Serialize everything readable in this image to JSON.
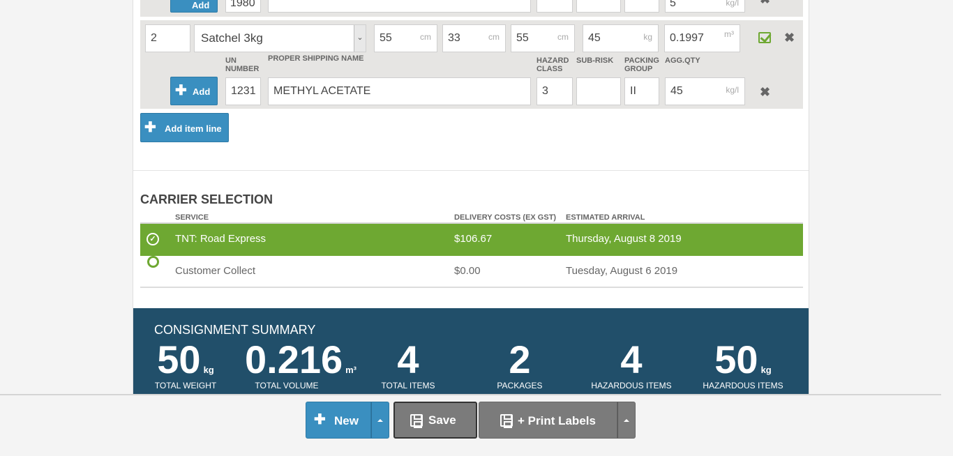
{
  "top_partial_row": {
    "un_number": "1980",
    "agg_qty": "5",
    "agg_unit": "kg/l",
    "add_label": "Add"
  },
  "item_line": {
    "quantity": "2",
    "package_type": "Satchel 3kg",
    "length": "55",
    "length_unit": "cm",
    "width": "33",
    "width_unit": "cm",
    "height": "55",
    "height_unit": "cm",
    "weight": "45",
    "weight_unit": "kg",
    "volume": "0.1997",
    "volume_unit": "m³"
  },
  "dg_headers": {
    "un_number": "UN NUMBER",
    "proper_shipping_name": "PROPER SHIPPING NAME",
    "hazard_class": "HAZARD CLASS",
    "sub_risk": "SUB-RISK",
    "packing_group": "PACKING GROUP",
    "agg_qty": "AGG.QTY"
  },
  "dg_line": {
    "add_label": "Add",
    "un_number": "1231",
    "proper_shipping_name": "METHYL ACETATE",
    "hazard_class": "3",
    "sub_risk": "",
    "packing_group": "II",
    "agg_qty": "45",
    "agg_unit": "kg/l"
  },
  "add_item_line_label": "Add item line",
  "carrier_selection": {
    "title": "CARRIER SELECTION",
    "col_service": "SERVICE",
    "col_cost": "DELIVERY COSTS (EX GST)",
    "col_arrival": "ESTIMATED ARRIVAL",
    "rows": [
      {
        "service": "TNT: Road Express",
        "cost": "$106.67",
        "arrival": "Thursday, August 8 2019",
        "selected": true
      },
      {
        "service": "Customer Collect",
        "cost": "$0.00",
        "arrival": "Tuesday, August 6 2019",
        "selected": false
      }
    ]
  },
  "summary": {
    "title": "CONSIGNMENT SUMMARY",
    "stats": [
      {
        "value": "50",
        "unit": "kg",
        "label": "TOTAL WEIGHT"
      },
      {
        "value": "0.216",
        "unit": "m³",
        "label": "TOTAL VOLUME"
      },
      {
        "value": "4",
        "unit": "",
        "label": "TOTAL ITEMS"
      },
      {
        "value": "2",
        "unit": "",
        "label": "PACKAGES"
      },
      {
        "value": "4",
        "unit": "",
        "label": "HAZARDOUS ITEMS"
      },
      {
        "value": "50",
        "unit": "kg",
        "label": "HAZARDOUS ITEMS"
      }
    ]
  },
  "footer": {
    "new_label": "New",
    "save_label": "Save",
    "print_label": "+ Print Labels"
  },
  "colors": {
    "accent_blue": "#3a8fc0",
    "selected_green": "#6ea832",
    "summary_bg": "#214f6a",
    "footer_gray": "#7b7b7b"
  }
}
